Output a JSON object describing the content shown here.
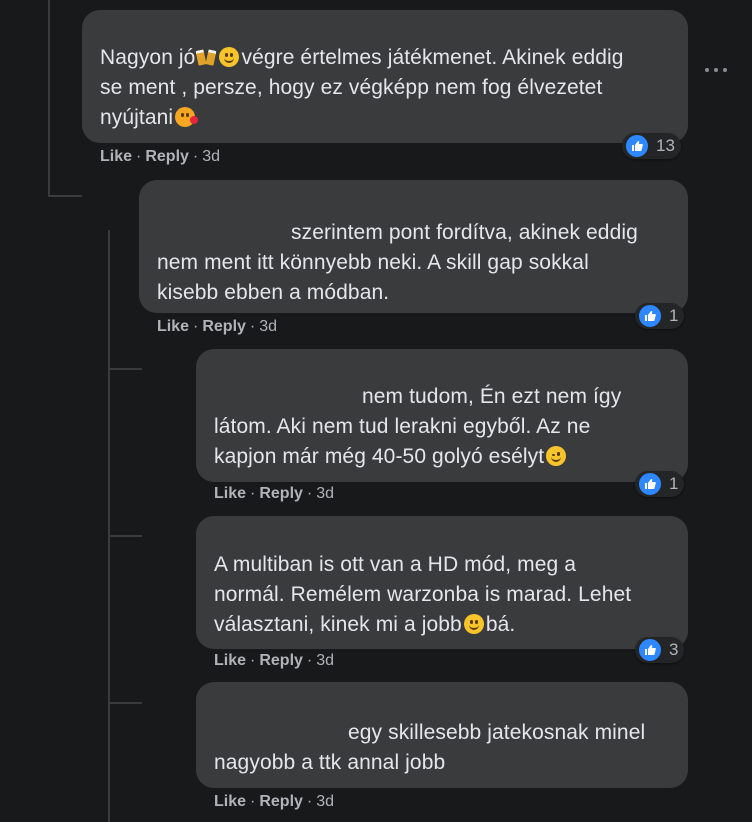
{
  "comments": [
    {
      "segments": [
        "Nagyon jó",
        "végre értelmes játékmenet. Akinek eddig se ment , persze, hogy ez végképp nem fog élvezetet nyújtani"
      ],
      "lines": [
        "Nagyon jó",
        "végre értelmes játékmenet. Akinek eddig",
        "se ment , persze, hogy ez végképp nem fog élvezetet",
        "nyújtani"
      ],
      "like": "Like",
      "reply": "Reply",
      "time": "3d",
      "reactions": "13",
      "icons": [
        "beer-mugs-icon",
        "grinning-face-icon",
        "kissing-face-icon"
      ]
    },
    {
      "lines": [
        "szerintem pont fordítva, akinek eddig",
        "nem ment itt könnyebb neki. A skill gap sokkal",
        "kisebb ebben a módban."
      ],
      "like": "Like",
      "reply": "Reply",
      "time": "3d",
      "reactions": "1"
    },
    {
      "lines": [
        "nem tudom, Én ezt nem így",
        "látom. Aki nem tud lerakni egyből. Az ne",
        "kapjon már még 40-50 golyó esélyt"
      ],
      "like": "Like",
      "reply": "Reply",
      "time": "3d",
      "reactions": "1",
      "icons": [
        "winking-face-icon"
      ]
    },
    {
      "lines": [
        "A multiban is ott van a HD mód, meg a",
        "normál. Remélem warzonba is marad. Lehet",
        "választani, kinek mi a jobb",
        "bá."
      ],
      "like": "Like",
      "reply": "Reply",
      "time": "3d",
      "reactions": "3",
      "icons": [
        "smiling-face-icon"
      ]
    },
    {
      "lines": [
        "egy skillesebb jatekosnak minel",
        "nagyobb a ttk annal jobb"
      ],
      "like": "Like",
      "reply": "Reply",
      "time": "3d"
    }
  ],
  "colors": {
    "background": "#18191a",
    "bubble": "#3a3b3c",
    "text": "#e4e6eb",
    "meta": "#b0b3b8",
    "like_blue": "#2d88ff"
  }
}
